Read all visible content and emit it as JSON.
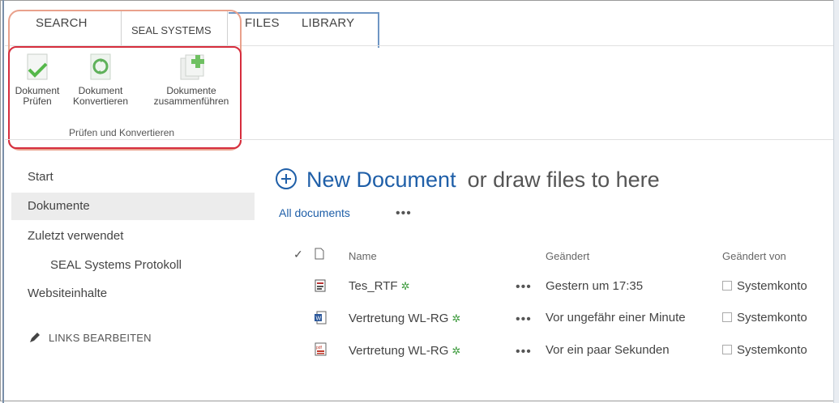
{
  "tabs": {
    "search": "SEARCH",
    "seal_systems": "SEAL SYSTEMS",
    "files": "FILES",
    "library": "LIBRARY"
  },
  "ribbon": {
    "buttons": [
      {
        "line1": "Dokument",
        "line2": "Prüfen"
      },
      {
        "line1": "Dokument",
        "line2": "Konvertieren"
      },
      {
        "line1": "Dokumente",
        "line2": "zusammenführen"
      }
    ],
    "group_label": "Prüfen und Konvertieren"
  },
  "nav": {
    "items": [
      {
        "label": "Start"
      },
      {
        "label": "Dokumente"
      },
      {
        "label": "Zuletzt verwendet"
      },
      {
        "label": "SEAL Systems Protokoll"
      },
      {
        "label": "Websiteinhalte"
      }
    ],
    "edit_links": "LINKS BEARBEITEN"
  },
  "main": {
    "new_document": "New Document",
    "drag_hint": "or draw files to here",
    "view_all": "All documents",
    "more": "•••"
  },
  "list": {
    "columns": {
      "check": "✓",
      "name": "Name",
      "modified": "Geändert",
      "modified_by": "Geändert von"
    },
    "rows": [
      {
        "type_icon": "rtf-file-icon",
        "name": "Tes_RTF",
        "new_marker": "✲",
        "menu": "•••",
        "modified": "Gestern um 17:35",
        "modified_by": "Systemkonto"
      },
      {
        "type_icon": "word-file-icon",
        "name": "Vertretung WL-RG",
        "new_marker": "✲",
        "menu": "•••",
        "modified": "Vor ungefähr einer Minute",
        "modified_by": "Systemkonto"
      },
      {
        "type_icon": "pdf-file-icon",
        "name": "Vertretung WL-RG",
        "new_marker": "✲",
        "menu": "•••",
        "modified": "Vor ein paar Sekunden",
        "modified_by": "Systemkonto"
      }
    ]
  },
  "colors": {
    "accent_blue": "#1f5fa8",
    "highlight_red": "#d62d3d",
    "highlight_orange": "#e9a18c",
    "new_green": "#3c9a3c"
  }
}
